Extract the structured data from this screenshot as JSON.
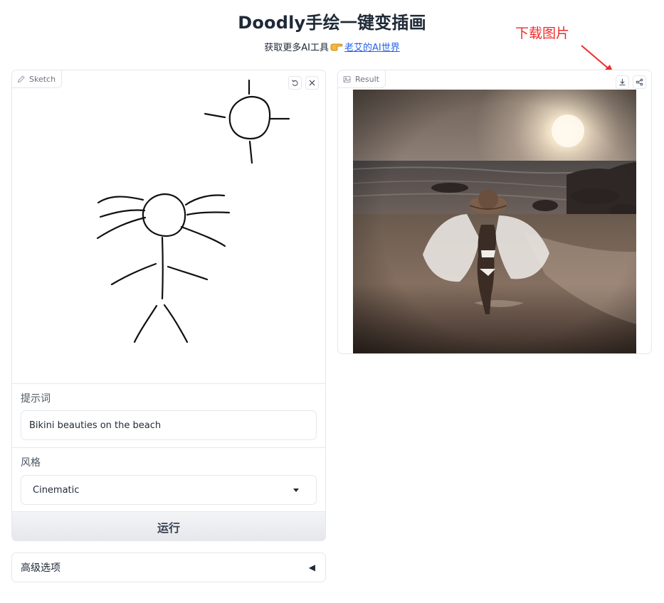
{
  "header": {
    "title": "Doodly手绘一键变插画",
    "subtitle_prefix": "获取更多AI工具",
    "subtitle_link": "老艾的AI世界"
  },
  "annotation": {
    "text": "下载图片",
    "color": "#ef2b2b"
  },
  "sketch": {
    "tab_label": "Sketch",
    "undo_icon": "undo-icon",
    "clear_icon": "close-icon"
  },
  "prompt": {
    "label": "提示词",
    "value": "Bikini beauties on the beach"
  },
  "style": {
    "label": "风格",
    "value": "Cinematic"
  },
  "run_button": "运行",
  "result": {
    "tab_label": "Result",
    "download_icon": "download-icon",
    "share_icon": "share-icon"
  },
  "advanced": {
    "label": "高级选项",
    "toggle": "◀"
  }
}
